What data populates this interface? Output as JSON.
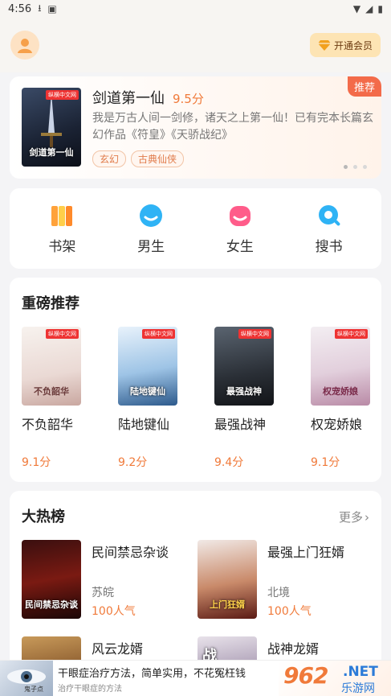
{
  "status": {
    "time": "4:56"
  },
  "header": {
    "vip_label": "开通会员"
  },
  "banner": {
    "tag": "推荐",
    "title": "剑道第一仙",
    "score": "9.5分",
    "description": "我是万古人间一剑修，诸天之上第一仙！已有完本长篇玄幻作品《符皇》《天骄战纪》",
    "chips": [
      "玄幻",
      "古典仙侠"
    ],
    "cover_title": "剑道第一仙",
    "cover_badge": "纵横中文网"
  },
  "nav": [
    {
      "label": "书架",
      "icon": "bookshelf-icon",
      "color": "#ffa23a"
    },
    {
      "label": "男生",
      "icon": "male-icon",
      "color": "#2fb3f5"
    },
    {
      "label": "女生",
      "icon": "female-icon",
      "color": "#ff5c8a"
    },
    {
      "label": "搜书",
      "icon": "search-icon",
      "color": "#2fb3f5"
    }
  ],
  "recommend": {
    "title": "重磅推荐",
    "items": [
      {
        "name": "不负韶华",
        "score": "9.1分",
        "cover_title": "不负韶华",
        "cover_badge": "纵横中文网"
      },
      {
        "name": "陆地键仙",
        "score": "9.2分",
        "cover_title": "陆地键仙",
        "cover_badge": "纵横中文网"
      },
      {
        "name": "最强战神",
        "score": "9.4分",
        "cover_title": "最强战神",
        "cover_badge": "纵横中文网"
      },
      {
        "name": "权宠娇娘",
        "score": "9.1分",
        "cover_title": "权宠娇娘",
        "cover_badge": "纵横中文网"
      }
    ]
  },
  "hot": {
    "title": "大热榜",
    "more_label": "更多",
    "items": [
      {
        "name": "民间禁忌杂谈",
        "author": "苏皖",
        "popularity": "100人气",
        "cover_title": "民间禁忌杂谈"
      },
      {
        "name": "最强上门狂婿",
        "author": "北境",
        "popularity": "100人气",
        "cover_title": "上门狂婿"
      },
      {
        "name": "风云龙婿",
        "cover_title": ""
      },
      {
        "name": "战神龙婿",
        "cover_title": "战"
      }
    ]
  },
  "ad": {
    "title": "干眼症治疗方法，简单实用，不花冤枉钱",
    "subtitle": "治疗干眼症的方法",
    "img_caption": "鬼子点",
    "brand_big": "962",
    "brand_net": ".NET",
    "brand_site": "乐游网"
  }
}
